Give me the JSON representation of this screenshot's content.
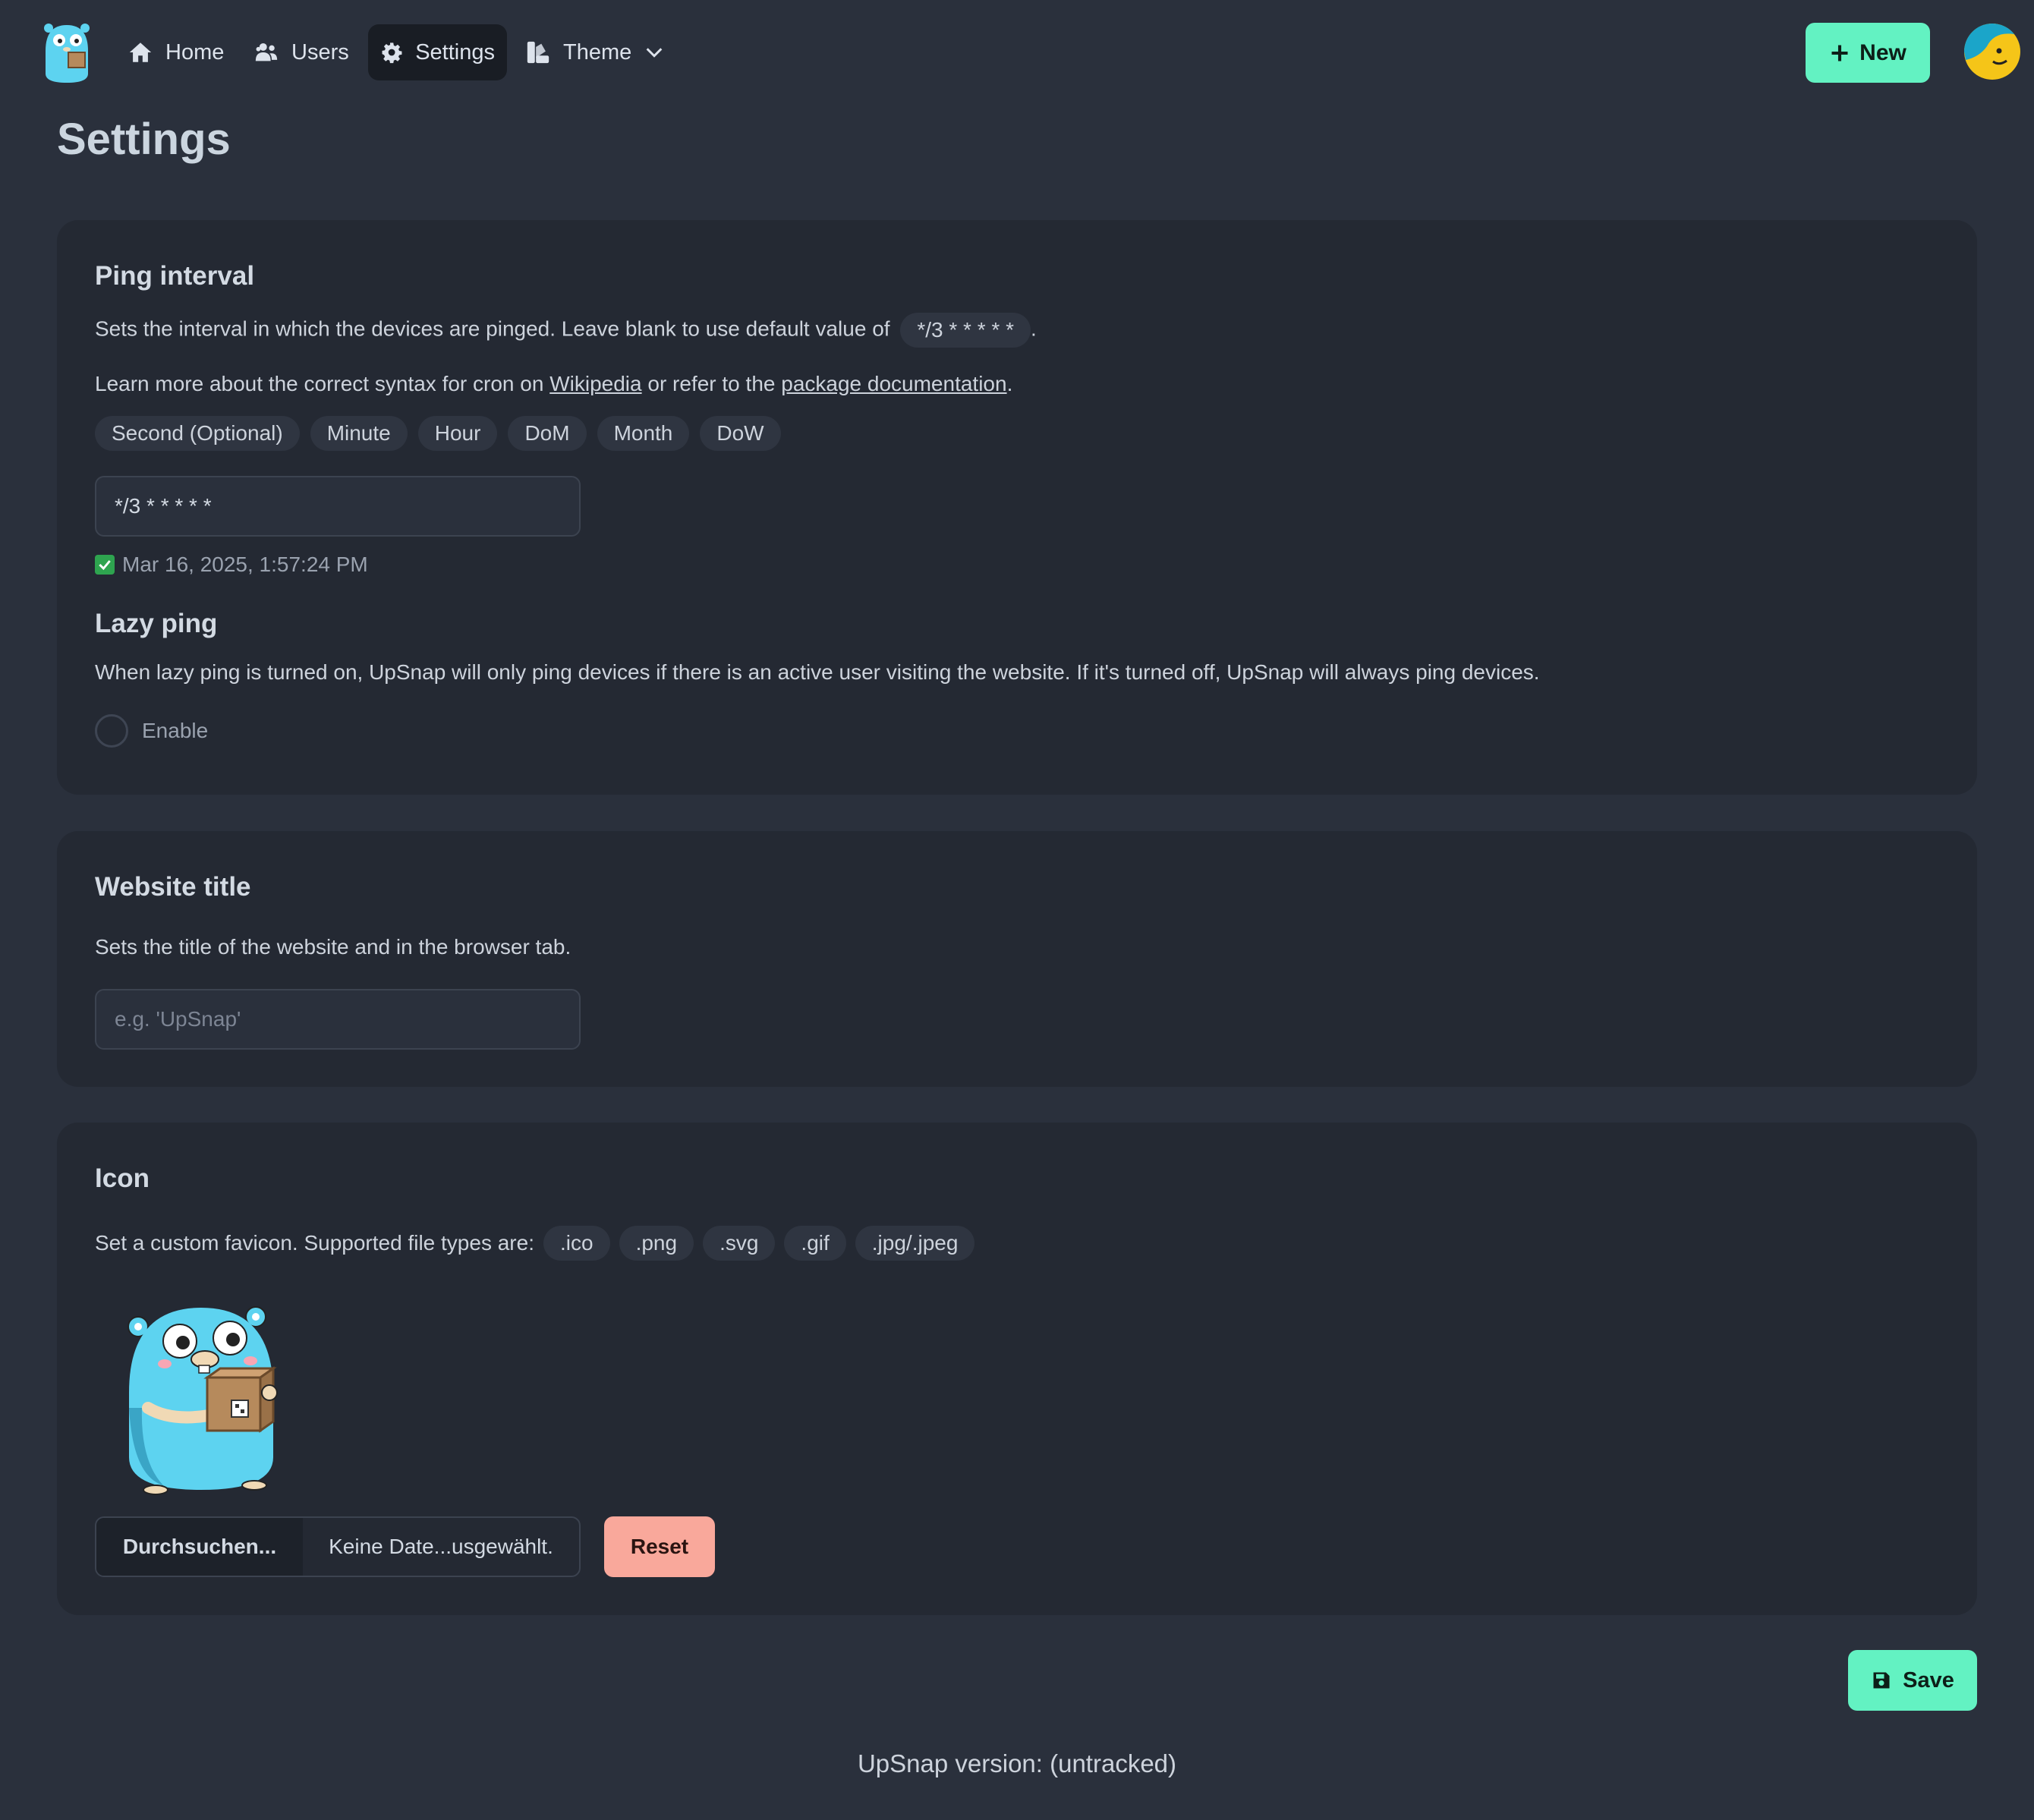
{
  "nav": {
    "home": "Home",
    "users": "Users",
    "settings": "Settings",
    "theme": "Theme",
    "new_button": "New"
  },
  "page": {
    "title": "Settings"
  },
  "ping": {
    "heading": "Ping interval",
    "desc": "Sets the interval in which the devices are pinged. Leave blank to use default value of",
    "default_value": "*/3 * * * * *",
    "desc_end": ".",
    "learn_prefix": "Learn more about the correct syntax for cron on",
    "wikipedia": "Wikipedia",
    "learn_mid": "or refer to the",
    "package_docs": "package documentation",
    "learn_end": ".",
    "fields": [
      "Second (Optional)",
      "Minute",
      "Hour",
      "DoM",
      "Month",
      "DoW"
    ],
    "input_value": "*/3 * * * * *",
    "next_run": "Mar 16, 2025, 1:57:24 PM"
  },
  "lazy": {
    "heading": "Lazy ping",
    "desc": "When lazy ping is turned on, UpSnap will only ping devices if there is an active user visiting the website. If it's turned off, UpSnap will always ping devices.",
    "toggle_label": "Enable",
    "enabled": false
  },
  "website": {
    "heading": "Website title",
    "desc": "Sets the title of the website and in the browser tab.",
    "placeholder": "e.g. 'UpSnap'"
  },
  "icon": {
    "heading": "Icon",
    "desc": "Set a custom favicon. Supported file types are:",
    "types": [
      ".ico",
      ".png",
      ".svg",
      ".gif",
      ".jpg/.jpeg"
    ],
    "browse": "Durchsuchen...",
    "no_file": "Keine Date...usgewählt.",
    "reset": "Reset"
  },
  "save": "Save",
  "footer": "UpSnap version: (untracked)",
  "colors": {
    "accent": "#63f2c2",
    "reset": "#f9a89b",
    "background": "#2a303c",
    "card": "#242933"
  }
}
